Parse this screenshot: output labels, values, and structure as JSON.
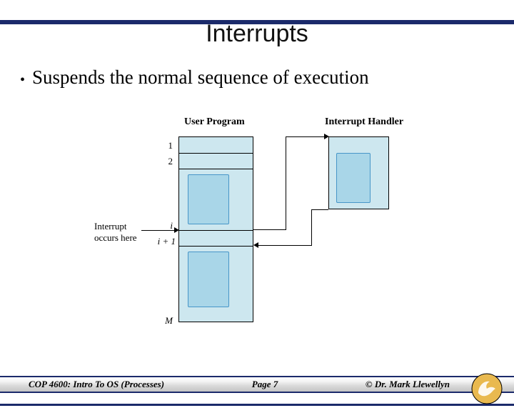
{
  "title": "Interrupts",
  "bullet": "Suspends the normal sequence of execution",
  "diagram": {
    "userProgramLabel": "User Program",
    "interruptHandlerLabel": "Interrupt Handler",
    "rows": {
      "r1": "1",
      "r2": "2",
      "ri": "i",
      "ri1": "i + 1",
      "rM": "M"
    },
    "interruptNote": "Interrupt\noccurs here"
  },
  "footer": {
    "course": "COP 4600: Intro To OS  (Processes)",
    "page": "Page 7",
    "author": "© Dr. Mark Llewellyn"
  }
}
